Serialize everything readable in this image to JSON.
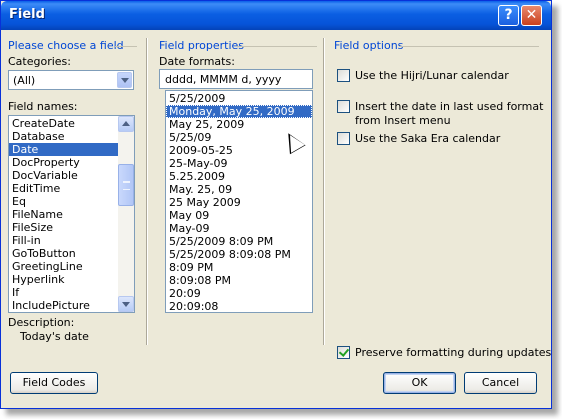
{
  "window": {
    "title": "Field",
    "help_glyph": "?",
    "close_glyph": "✕"
  },
  "left": {
    "heading": "Please choose a field",
    "categories_label": "Categories:",
    "categories_value": "(All)",
    "field_names_label": "Field names:",
    "field_names": [
      "CreateDate",
      "Database",
      "Date",
      "DocProperty",
      "DocVariable",
      "EditTime",
      "Eq",
      "FileName",
      "FileSize",
      "Fill-in",
      "GoToButton",
      "GreetingLine",
      "Hyperlink",
      "If",
      "IncludePicture"
    ],
    "selected_field": "Date",
    "description_label": "Description:",
    "description_text": "Today's date"
  },
  "middle": {
    "heading": "Field properties",
    "date_formats_label": "Date formats:",
    "format_input": "dddd, MMMM d, yyyy",
    "formats": [
      "5/25/2009",
      "Monday, May 25, 2009",
      "May 25, 2009",
      "5/25/09",
      "2009-05-25",
      "25-May-09",
      "5.25.2009",
      "May. 25, 09",
      "25 May 2009",
      "May 09",
      "May-09",
      "5/25/2009 8:09 PM",
      "5/25/2009 8:09:08 PM",
      "8:09 PM",
      "8:09:08 PM",
      "20:09",
      "20:09:08"
    ],
    "selected_format": "Monday, May 25, 2009"
  },
  "right": {
    "heading": "Field options",
    "hijri_label": "Use the Hijri/Lunar calendar",
    "last_used_label_1": "Insert the date in last used format",
    "last_used_label_2": "from Insert menu",
    "saka_label": "Use the Saka Era calendar",
    "preserve_label": "Preserve formatting during updates"
  },
  "buttons": {
    "field_codes": "Field Codes",
    "ok": "OK",
    "cancel": "Cancel"
  },
  "colors": {
    "title_blue": "#0a5fe8",
    "selection": "#316ac5",
    "heading": "#0046d5",
    "face": "#ece9d8"
  }
}
